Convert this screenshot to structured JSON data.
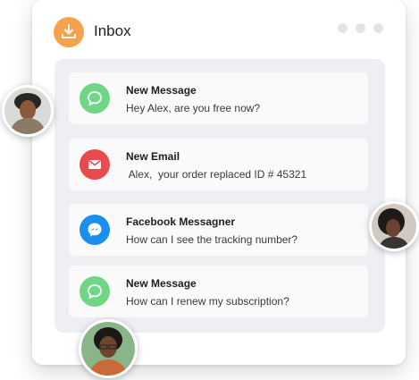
{
  "header": {
    "title": "Inbox",
    "icon": "inbox-download-icon",
    "accent_color": "#f6a24d"
  },
  "window_controls": [
    "dot",
    "dot",
    "dot"
  ],
  "messages": [
    {
      "title": "New Message",
      "text": "Hey Alex, are you free now?",
      "icon": "chat-bubble-icon",
      "color": "#6fd685"
    },
    {
      "title": "New Email",
      "text": " Alex,  your order replaced ID # 45321",
      "icon": "mail-icon",
      "color": "#e84a4f"
    },
    {
      "title": "Facebook Messagner",
      "text": "How can I see the tracking number?",
      "icon": "messenger-icon",
      "color": "#1b8ff0"
    },
    {
      "title": "New Message",
      "text": "How can I renew my subscription?",
      "icon": "chat-bubble-icon",
      "color": "#6fd685"
    }
  ]
}
